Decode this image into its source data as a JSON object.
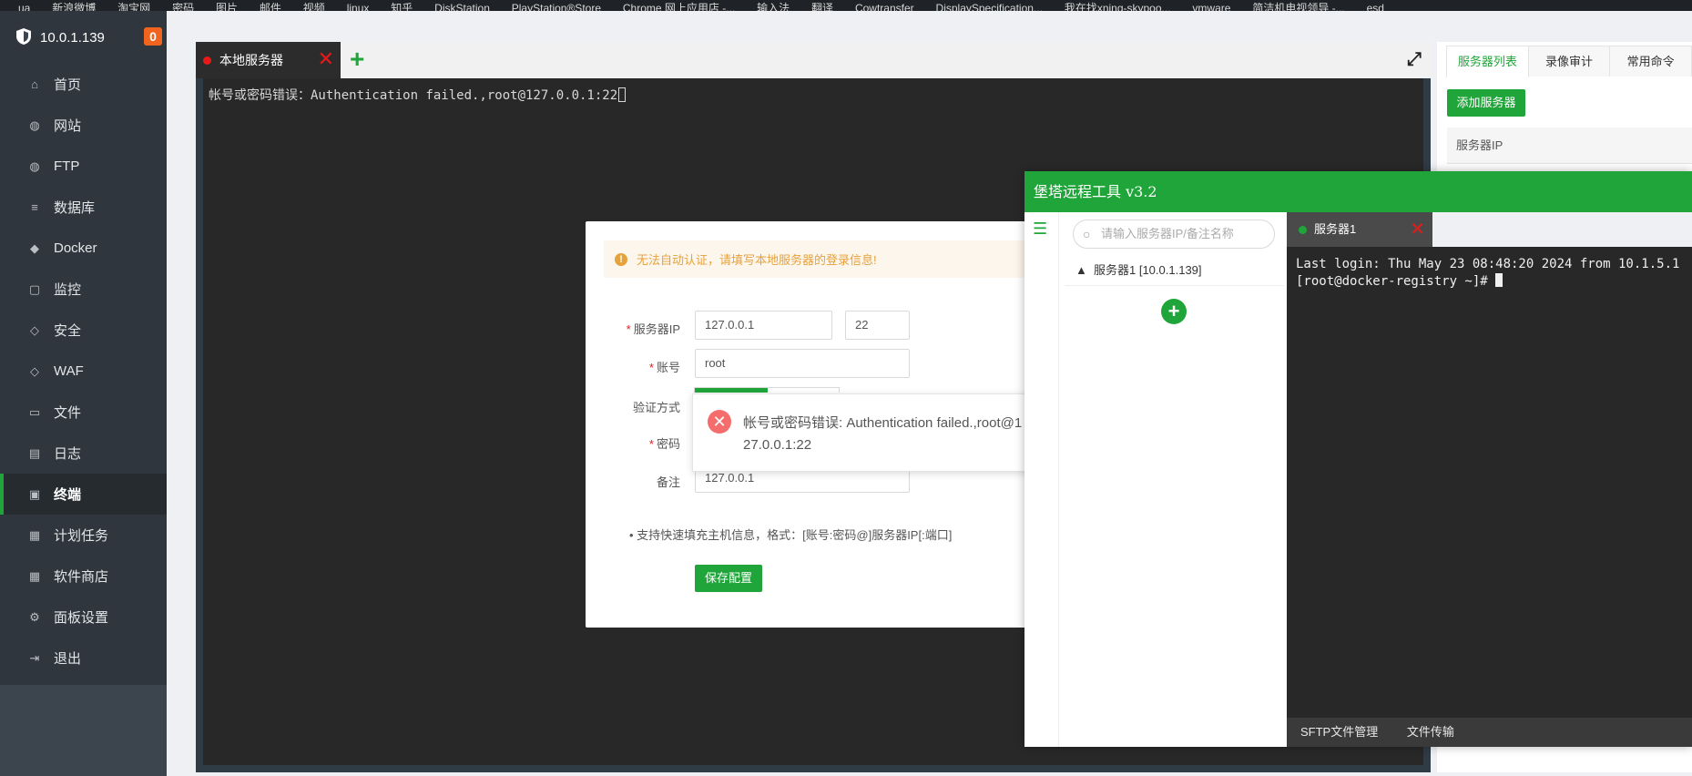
{
  "bookmarks": [
    "ua",
    "新浪微博",
    "淘宝网",
    "密码",
    "图片",
    "邮件",
    "视频",
    "linux",
    "知乎",
    "DiskStation",
    "PlayStation®Store",
    "Chrome 网上应用店 -...",
    "输入法",
    "翻译",
    "Cowtransfer",
    "DisplaySpecification...",
    "我在找xning-skypoo...",
    "vmware",
    "简洁机电视领导 -...",
    "esd"
  ],
  "sidebar": {
    "host": "10.0.1.139",
    "badge": "0",
    "items": [
      {
        "label": "首页",
        "icon": "home-icon"
      },
      {
        "label": "网站",
        "icon": "globe-icon"
      },
      {
        "label": "FTP",
        "icon": "ftp-icon"
      },
      {
        "label": "数据库",
        "icon": "database-icon"
      },
      {
        "label": "Docker",
        "icon": "docker-icon"
      },
      {
        "label": "监控",
        "icon": "monitor-icon"
      },
      {
        "label": "安全",
        "icon": "shield-icon"
      },
      {
        "label": "WAF",
        "icon": "waf-icon"
      },
      {
        "label": "文件",
        "icon": "folder-icon"
      },
      {
        "label": "日志",
        "icon": "log-icon"
      },
      {
        "label": "终端",
        "icon": "terminal-icon",
        "active": true
      },
      {
        "label": "计划任务",
        "icon": "calendar-icon"
      },
      {
        "label": "软件商店",
        "icon": "store-icon"
      },
      {
        "label": "面板设置",
        "icon": "gear-icon"
      },
      {
        "label": "退出",
        "icon": "logout-icon"
      }
    ]
  },
  "terminal": {
    "tab_label": "本地服务器",
    "output": "帐号或密码错误：Authentication failed.,root@127.0.0.1:22"
  },
  "modal": {
    "warning": "无法自动认证，请填写本地服务器的登录信息!",
    "server_ip_label": "服务器IP",
    "server_ip": "127.0.0.1",
    "port": "22",
    "account_label": "账号",
    "account": "root",
    "auth_label": "验证方式",
    "password_label": "密码",
    "note_label": "备注",
    "note": "127.0.0.1",
    "tip": "• 支持快速填充主机信息，格式：[账号:密码@]服务器IP[:端口]",
    "save_label": "保存配置"
  },
  "toast": {
    "message": "帐号或密码错误: Authentication failed.,root@127.0.0.1:22"
  },
  "right_panel": {
    "tabs": [
      "服务器列表",
      "录像审计",
      "常用命令"
    ],
    "add_server_label": "添加服务器",
    "column_server_ip": "服务器IP"
  },
  "bt_tool": {
    "title": "堡塔远程工具 v3.2",
    "search_placeholder": "请输入服务器IP/备注名称",
    "server_item": "服务器1 [10.0.1.139]",
    "tab_label": "服务器1",
    "output": "Last login: Thu May 23 08:48:20 2024 from 10.1.5.1\n[root@docker-registry ~]# ",
    "footer": [
      "SFTP文件管理",
      "文件传输"
    ]
  },
  "colors": {
    "accent": "#20a53a",
    "sidebar_bg": "#2f363d",
    "terminal_bg": "#282828",
    "error": "#e81919",
    "warning": "#e6a23c"
  }
}
